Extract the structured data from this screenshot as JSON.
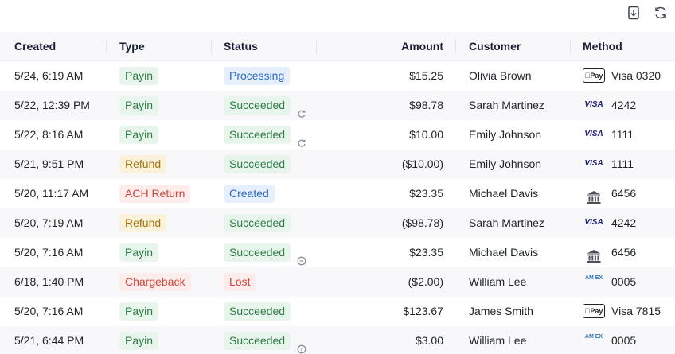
{
  "toolbar": {
    "download_icon": "download-icon",
    "refresh_icon": "refresh-icon"
  },
  "columns": {
    "created": "Created",
    "type": "Type",
    "status": "Status",
    "amount": "Amount",
    "customer": "Customer",
    "method": "Method"
  },
  "colors": {
    "green": "#2f7d46",
    "blue": "#2e6bc6",
    "yellow": "#a6730b",
    "red": "#d0463a"
  },
  "rows": [
    {
      "created": "5/24, 6:19 AM",
      "type": "Payin",
      "type_color": "green",
      "status": "Processing",
      "status_color": "blue",
      "status_icon": "",
      "amount": "$15.25",
      "customer": "Olivia Brown",
      "method_icon": "applepay",
      "method_icon_text": "Pay",
      "method": "Visa 0320"
    },
    {
      "created": "5/22, 12:39 PM",
      "type": "Payin",
      "type_color": "green",
      "status": "Succeeded",
      "status_color": "green",
      "status_icon": "refund-icon",
      "amount": "$98.78",
      "customer": "Sarah Martinez",
      "method_icon": "visa",
      "method_icon_text": "VISA",
      "method": "4242"
    },
    {
      "created": "5/22, 8:16 AM",
      "type": "Payin",
      "type_color": "green",
      "status": "Succeeded",
      "status_color": "green",
      "status_icon": "refund-icon",
      "amount": "$10.00",
      "customer": "Emily Johnson",
      "method_icon": "visa",
      "method_icon_text": "VISA",
      "method": "1111"
    },
    {
      "created": "5/21, 9:51 PM",
      "type": "Refund",
      "type_color": "yellow",
      "status": "Succeeded",
      "status_color": "green",
      "status_icon": "",
      "amount": "($10.00)",
      "customer": "Emily Johnson",
      "method_icon": "visa",
      "method_icon_text": "VISA",
      "method": "1111"
    },
    {
      "created": "5/20, 11:17 AM",
      "type": "ACH Return",
      "type_color": "red",
      "status": "Created",
      "status_color": "blue",
      "status_icon": "",
      "amount": "$23.35",
      "customer": "Michael Davis",
      "method_icon": "bank",
      "method_icon_text": "",
      "method": "6456"
    },
    {
      "created": "5/20, 7:19 AM",
      "type": "Refund",
      "type_color": "yellow",
      "status": "Succeeded",
      "status_color": "green",
      "status_icon": "",
      "amount": "($98.78)",
      "customer": "Sarah Martinez",
      "method_icon": "visa",
      "method_icon_text": "VISA",
      "method": "4242"
    },
    {
      "created": "5/20, 7:16 AM",
      "type": "Payin",
      "type_color": "green",
      "status": "Succeeded",
      "status_color": "green",
      "status_icon": "minus-circle-icon",
      "amount": "$23.35",
      "customer": "Michael Davis",
      "method_icon": "bank",
      "method_icon_text": "",
      "method": "6456"
    },
    {
      "created": "6/18, 1:40 PM",
      "type": "Chargeback",
      "type_color": "red",
      "status": "Lost",
      "status_color": "red",
      "status_icon": "",
      "amount": "($2.00)",
      "customer": "William Lee",
      "method_icon": "amex",
      "method_icon_text": "AM EX",
      "method": "0005"
    },
    {
      "created": "5/20, 7:16 AM",
      "type": "Payin",
      "type_color": "green",
      "status": "Succeeded",
      "status_color": "green",
      "status_icon": "",
      "amount": "$123.67",
      "customer": "James Smith",
      "method_icon": "applepay",
      "method_icon_text": "Pay",
      "method": "Visa 7815"
    },
    {
      "created": "5/21, 6:44 PM",
      "type": "Payin",
      "type_color": "green",
      "status": "Succeeded",
      "status_color": "green",
      "status_icon": "info-icon",
      "amount": "$3.00",
      "customer": "William Lee",
      "method_icon": "amex",
      "method_icon_text": "AM EX",
      "method": "0005"
    }
  ]
}
